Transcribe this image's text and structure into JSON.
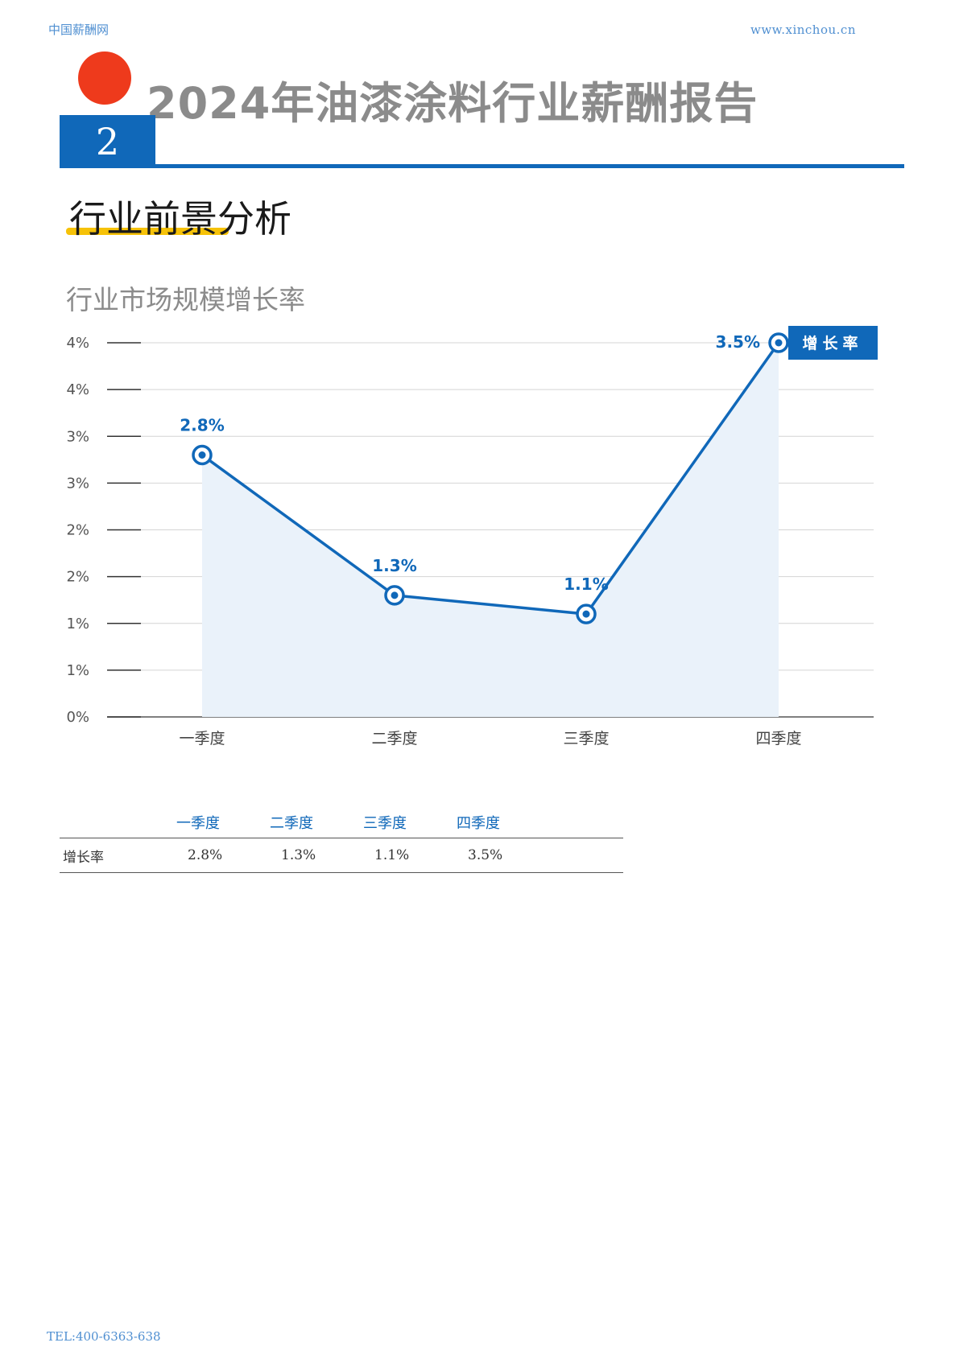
{
  "header": {
    "site_name": "中国薪酬网",
    "site_url": "www.xinchou.cn"
  },
  "report": {
    "title": "2024年油漆涂料行业薪酬报告",
    "chapter_number": "2"
  },
  "section": {
    "title": "行业前景分析"
  },
  "chart_title": "行业市场规模增长率",
  "chart_data": {
    "type": "area",
    "categories": [
      "一季度",
      "二季度",
      "三季度",
      "四季度"
    ],
    "series": [
      {
        "name": "增长率",
        "values": [
          2.8,
          1.3,
          1.1,
          3.5
        ],
        "labels": [
          "2.8%",
          "1.3%",
          "1.1%",
          "3.5%"
        ]
      }
    ],
    "y_tick_labels": [
      "0%",
      "1%",
      "1%",
      "2%",
      "2%",
      "3%",
      "3%",
      "4%",
      "4%"
    ],
    "ylim": [
      0,
      4
    ],
    "grid": true,
    "legend_position": "right",
    "colors": {
      "line": "#1068b9",
      "fill": "#eaf2fa",
      "grid": "#d4d4d4"
    }
  },
  "table": {
    "headers": [
      "",
      "一季度",
      "二季度",
      "三季度",
      "四季度"
    ],
    "rows": [
      {
        "label": "增长率",
        "cells": [
          "2.8%",
          "1.3%",
          "1.1%",
          "3.5%"
        ]
      }
    ]
  },
  "footer": {
    "tel": "TEL:400-6363-638"
  }
}
